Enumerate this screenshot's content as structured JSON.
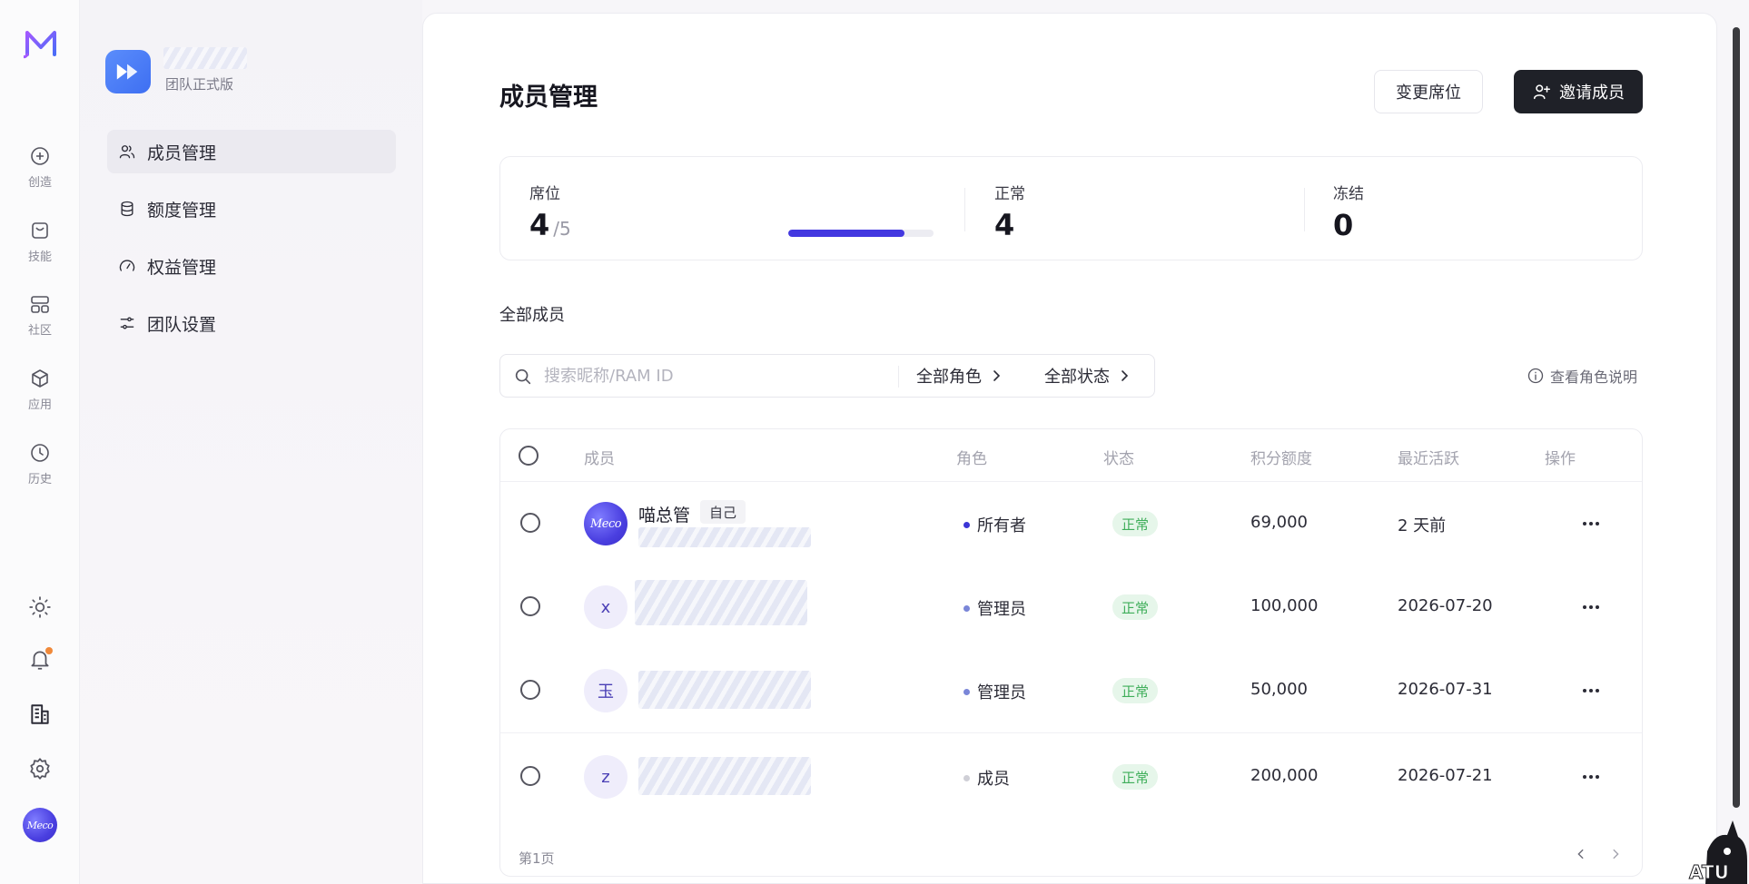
{
  "rail": {
    "items": [
      {
        "label": "创造",
        "icon": "plus-circle-icon"
      },
      {
        "label": "技能",
        "icon": "bag-icon"
      },
      {
        "label": "社区",
        "icon": "grid-icon"
      },
      {
        "label": "应用",
        "icon": "cube-icon"
      },
      {
        "label": "历史",
        "icon": "clock-icon"
      }
    ],
    "bottom_icons": [
      "sun-icon",
      "bell-icon",
      "building-icon",
      "gear-icon"
    ],
    "avatar_text": "Meco"
  },
  "sidebar": {
    "team_plan": "团队正式版",
    "items": [
      {
        "label": "成员管理",
        "active": true
      },
      {
        "label": "额度管理",
        "active": false
      },
      {
        "label": "权益管理",
        "active": false
      },
      {
        "label": "团队设置",
        "active": false
      }
    ]
  },
  "header": {
    "title": "成员管理",
    "change_seats_label": "变更席位",
    "invite_label": "邀请成员"
  },
  "stats": {
    "seats": {
      "label": "席位",
      "used": "4",
      "total": "/5",
      "fraction": 0.8
    },
    "normal": {
      "label": "正常",
      "value": "4"
    },
    "frozen": {
      "label": "冻结",
      "value": "0"
    }
  },
  "members_section": {
    "title": "全部成员",
    "search_placeholder": "搜索昵称/RAM ID",
    "role_filter": "全部角色",
    "status_filter": "全部状态",
    "role_help": "查看角色说明"
  },
  "table": {
    "columns": {
      "member": "成员",
      "role": "角色",
      "status": "状态",
      "credits": "积分额度",
      "last_active": "最近活跃",
      "actions": "操作"
    },
    "rows": [
      {
        "avatar": "Meco",
        "name": "喵总管",
        "tag": "自己",
        "role": "所有者",
        "role_color": "#3b35d6",
        "status": "正常",
        "credits": "69,000",
        "last_active": "2 天前"
      },
      {
        "avatar": "x",
        "name": "",
        "tag": "",
        "role": "管理员",
        "role_color": "#7a86d8",
        "status": "正常",
        "credits": "100,000",
        "last_active": "2026-07-20"
      },
      {
        "avatar": "玉",
        "name": "",
        "tag": "",
        "role": "管理员",
        "role_color": "#7a86d8",
        "status": "正常",
        "credits": "50,000",
        "last_active": "2026-07-31"
      },
      {
        "avatar": "z",
        "name": "",
        "tag": "",
        "role": "成员",
        "role_color": "#cfcfd6",
        "status": "正常",
        "credits": "200,000",
        "last_active": "2026-07-21"
      }
    ],
    "page_label": "第1页"
  },
  "colors": {
    "accent": "#4338e0",
    "invite_bg": "#1f2128",
    "status_green": "#3fae5a",
    "notification": "#f0893a"
  }
}
